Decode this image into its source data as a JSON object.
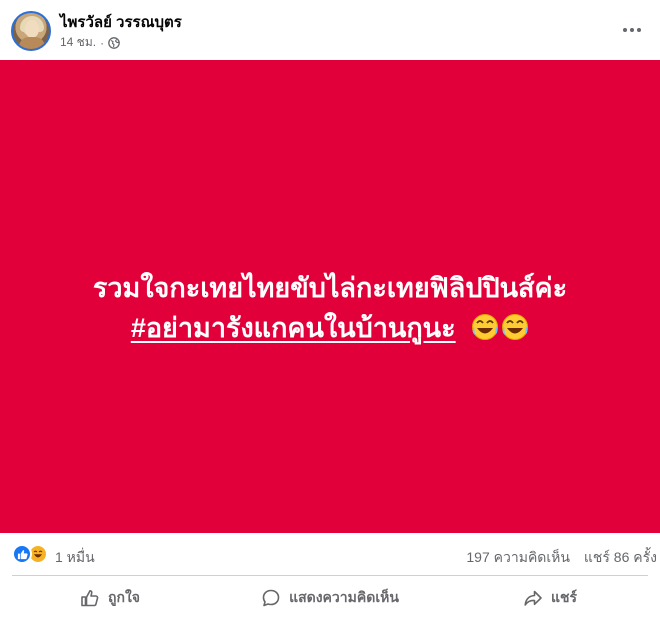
{
  "author": {
    "name": "ไพรวัลย์ วรรณบุตร"
  },
  "meta": {
    "time": "14 ชม.",
    "separator": "·",
    "privacy_icon": "globe-icon"
  },
  "menu_icon": "more-horizontal-icon",
  "post": {
    "background_color": "#e1003a",
    "text_color": "#ffffff",
    "line1": "รวมใจกะเทยไทยขับไล่กะเทยฟิลิปปินส์ค่ะ",
    "hashtag": "#อย่ามารังแกคนในบ้านกูนะ",
    "emoji": "😂😂"
  },
  "reactions": {
    "icons": [
      "like-reaction-icon",
      "haha-reaction-icon"
    ],
    "count": "1 หมื่น",
    "comments": "197 ความคิดเห็น",
    "shares": "แชร์ 86 ครั้ง"
  },
  "actions": {
    "like_label": "ถูกใจ",
    "comment_label": "แสดงความคิดเห็น",
    "share_label": "แชร์"
  },
  "colors": {
    "accent": "#1877f2",
    "secondary_text": "#65676b",
    "haha": "#f7b125"
  }
}
